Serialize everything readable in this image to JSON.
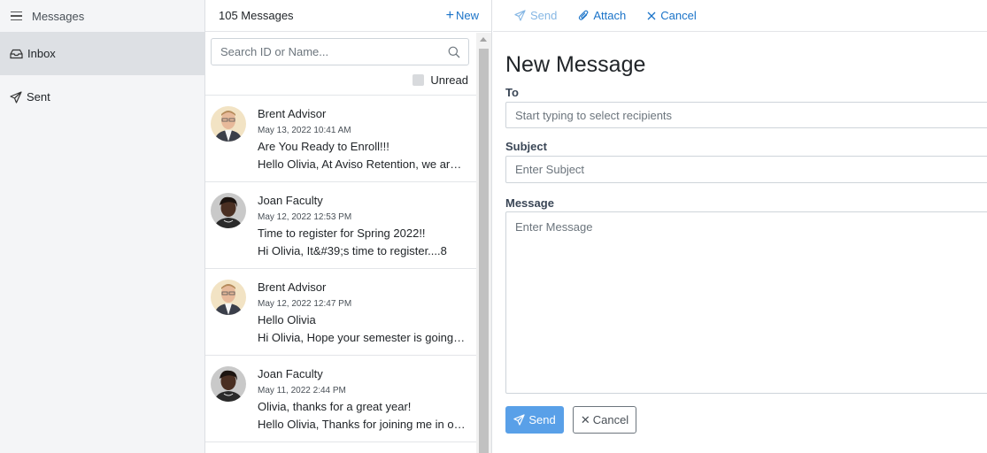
{
  "nav": {
    "title": "Messages",
    "items": [
      {
        "label": "Inbox",
        "icon": "inbox-icon",
        "active": true
      },
      {
        "label": "Sent",
        "icon": "send-icon",
        "active": false
      }
    ]
  },
  "list": {
    "count_label": "105 Messages",
    "new_label": "New",
    "search_placeholder": "Search ID or Name...",
    "unread_label": "Unread",
    "messages": [
      {
        "sender": "Brent Advisor",
        "date": "May 13, 2022 10:41 AM",
        "subject": "Are You Ready to Enroll!!!",
        "preview": "Hello Olivia, At Aviso Retention, we are excited to have you",
        "avatar": "advisor"
      },
      {
        "sender": "Joan Faculty",
        "date": "May 12, 2022 12:53 PM",
        "subject": "Time to register for Spring 2022!!",
        "preview": "Hi Olivia,   It&#39;s time to register....8",
        "avatar": "faculty"
      },
      {
        "sender": "Brent Advisor",
        "date": "May 12, 2022 12:47 PM",
        "subject": "Hello Olivia",
        "preview": "Hi Olivia, Hope your semester is going well",
        "avatar": "advisor"
      },
      {
        "sender": "Joan Faculty",
        "date": "May 11, 2022 2:44 PM",
        "subject": "Olivia, thanks for a great year!",
        "preview": "Hello Olivia, Thanks for joining me in our class",
        "avatar": "faculty"
      }
    ]
  },
  "compose": {
    "toolbar": {
      "send": "Send",
      "attach": "Attach",
      "cancel": "Cancel"
    },
    "title": "New Message",
    "to_label": "To",
    "to_placeholder": "Start typing to select recipients",
    "subject_label": "Subject",
    "subject_placeholder": "Enter Subject",
    "message_label": "Message",
    "message_placeholder": "Enter Message",
    "send_button": "Send",
    "cancel_button": "Cancel"
  },
  "colors": {
    "accent": "#1a73c8",
    "send_button": "#59a0e8",
    "nav_active": "#dde0e4"
  }
}
